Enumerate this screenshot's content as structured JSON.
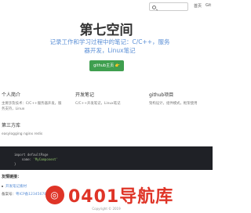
{
  "topbar": {
    "link_home": "首页",
    "link_github": "Git"
  },
  "hero": {
    "title": "第七空间",
    "subtitle": "记录工作和学习过程中的笔记：C/C++，服务器开发，Linux笔记",
    "button_label": "github主页 👉"
  },
  "columns": [
    {
      "title": "个人简介",
      "text": "主要涉及技术：C/C++服务器开发，服务支持，Linux"
    },
    {
      "title": "开发笔记",
      "text": "C/C++开发笔记，Linux笔记"
    },
    {
      "title": "github项目",
      "text": "架构设计，组件模式，框架使用"
    }
  ],
  "third_party": {
    "title": "第三方库",
    "text": "easylogging  nginx  redis"
  },
  "code": {
    "line1": "import  defaultPage",
    "line2_key": "name",
    "line2_value": "'MyComponent'",
    "line3": "}"
  },
  "friend_links": {
    "title": "友情链接：",
    "item": "开发笔记素材"
  },
  "beian": {
    "label": "备案号：",
    "value": "粤ICP备12345678号"
  },
  "watermark": {
    "icon": "◎",
    "text": "0401导航库"
  },
  "footer": {
    "copyright": "Copyright © 2019"
  }
}
